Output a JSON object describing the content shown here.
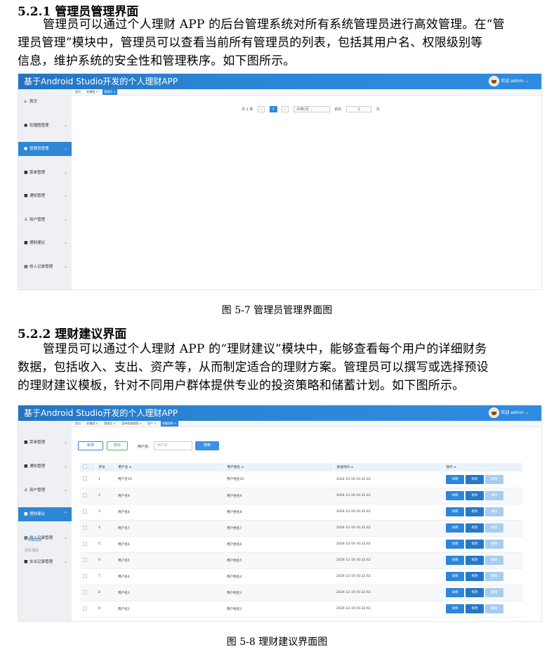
{
  "section1": {
    "heading": "5.2.1 管理员管理界面",
    "para_lines": [
      "管理员可以通过个人理财 APP 的后台管理系统对所有系统管理员进行高效管理。在“管",
      "理员管理”模块中，管理员可以查看当前所有管理员的列表，包括其用户名、权限级别等",
      "信息，维护系统的安全性和管理秩序。如下图所示。"
    ],
    "caption": "图 5-7 管理员管理界面图"
  },
  "section2": {
    "heading": "5.2.2 理财建议界面",
    "para_lines": [
      "管理员可以通过个人理财 APP 的“理财建议”模块中，能够查看每个用户的详细财务",
      "数据，包括收入、支出、资产等，从而制定适合的理财方案。管理员可以撰写或选择预设",
      "的理财建议模板，针对不同用户群体提供专业的投资策略和储蓄计划。如下图所示。"
    ],
    "caption": "图 5-8 理财建议界面图"
  },
  "app": {
    "title": "基于Android Studio开发的个人理财APP",
    "welcome": "欢迎 admin ⌄"
  },
  "shot1": {
    "tabs": [
      "首页",
      "轮播图",
      "管理员"
    ],
    "sidebar": [
      {
        "label": "首页",
        "icon": "⌂",
        "chev": ""
      },
      {
        "label": "轮播图管理",
        "icon": "●",
        "chev": "⌄"
      },
      {
        "label": "管理员管理",
        "icon": "●",
        "chev": "⌄",
        "active": true
      },
      {
        "label": "菜单管理",
        "icon": "■",
        "chev": "⌄"
      },
      {
        "label": "通知管理",
        "icon": "■",
        "chev": "⌄"
      },
      {
        "label": "用户管理",
        "icon": "♙",
        "chev": "⌄"
      },
      {
        "label": "理财建议",
        "icon": "■",
        "chev": "⌄"
      },
      {
        "label": "收入记录管理",
        "icon": "▦",
        "chev": "⌄"
      }
    ],
    "pager": {
      "total": "共 1 条",
      "prev": "‹",
      "page": "1",
      "next": "›",
      "size": "20条/页 ⌄",
      "goto": "前往",
      "goto_value": "1",
      "unit": "页"
    }
  },
  "shot2": {
    "tabs": [
      "首页",
      "轮播图",
      "管理员",
      "菜单权限管理",
      "用户",
      "收藏理财"
    ],
    "sidebar": [
      {
        "label": "菜单管理",
        "icon": "■",
        "chev": "⌄"
      },
      {
        "label": "通知管理",
        "icon": "■",
        "chev": "⌄"
      },
      {
        "label": "用户管理",
        "icon": "♙",
        "chev": "⌄"
      },
      {
        "label": "理财建议",
        "icon": "■",
        "chev": "^",
        "active": true
      },
      {
        "label": "收入记录管理",
        "icon": "▦",
        "chev": "⌄"
      },
      {
        "label": "支出记录管理",
        "icon": "■",
        "chev": "⌄"
      }
    ],
    "submenu": [
      "• 收藏理财",
      "进阶理财"
    ],
    "buttons": {
      "add": "新增",
      "delete": "删除",
      "search": "搜索"
    },
    "filter_label": "用户名:",
    "filter_placeholder": "用户名",
    "columns": [
      "序号",
      "用户名 ≑",
      "用户姓名 ≑",
      "发送时间 ≑",
      "操作 ≑"
    ],
    "rows": [
      {
        "no": "1",
        "user": "用户名10",
        "name": "用户姓名10",
        "time": "2024-12-19 16:32:42"
      },
      {
        "no": "2",
        "user": "用户名9",
        "name": "用户姓名9",
        "time": "2024-12-19 16:32:42"
      },
      {
        "no": "3",
        "user": "用户名8",
        "name": "用户姓名8",
        "time": "2024-12-19 16:32:42"
      },
      {
        "no": "4",
        "user": "用户名7",
        "name": "用户姓名7",
        "time": "2024-12-19 16:32:42"
      },
      {
        "no": "5",
        "user": "用户名6",
        "name": "用户姓名6",
        "time": "2024-12-19 16:32:42"
      },
      {
        "no": "6",
        "user": "用户名5",
        "name": "用户姓名5",
        "time": "2024-12-19 16:32:42"
      },
      {
        "no": "7",
        "user": "用户名4",
        "name": "用户姓名4",
        "time": "2024-12-19 16:32:42"
      },
      {
        "no": "8",
        "user": "用户名3",
        "name": "用户姓名3",
        "time": "2024-12-19 16:32:42"
      },
      {
        "no": "9",
        "user": "用户名2",
        "name": "用户姓名2",
        "time": "2024-12-19 16:32:42"
      }
    ],
    "actions": {
      "detail": "详情",
      "edit": "修改",
      "delete": "删除"
    }
  }
}
